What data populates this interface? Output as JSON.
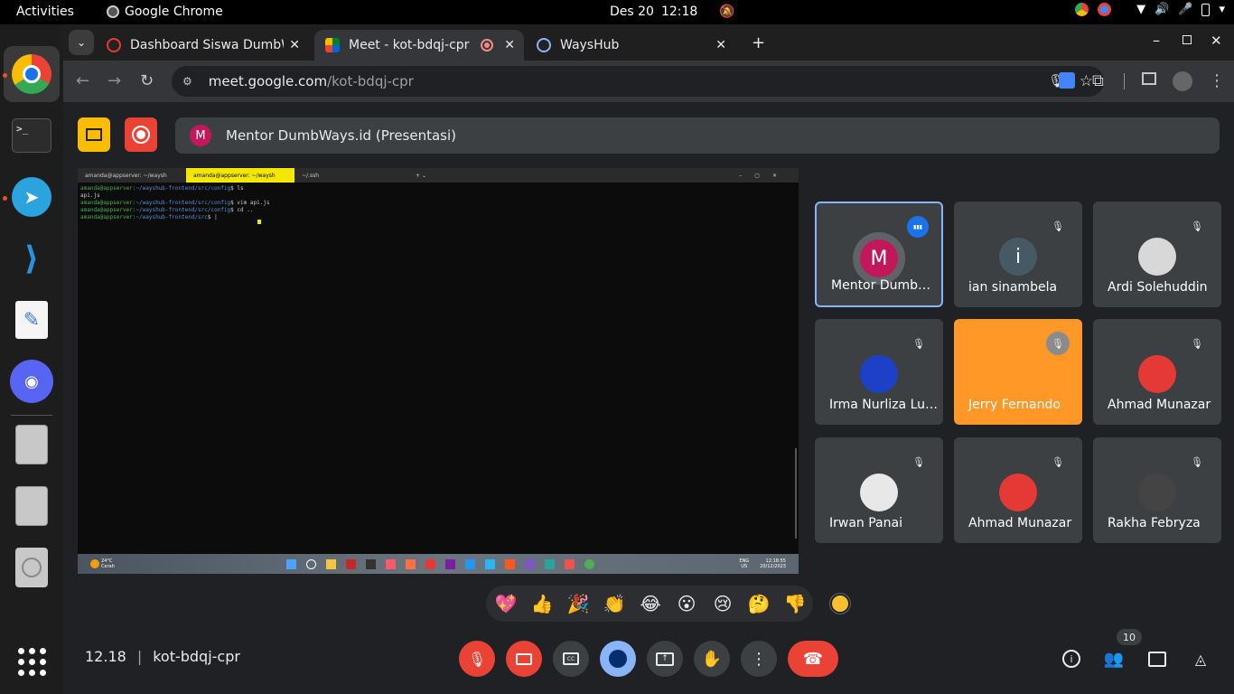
{
  "topbar": {
    "activities": "Activities",
    "app_name": "Google Chrome",
    "date": "Des 20",
    "time": "12:18"
  },
  "dock": {
    "items": [
      "chrome-icon",
      "terminal-icon",
      "telegram-icon",
      "vscode-icon",
      "text-editor-icon",
      "discord-icon",
      "drive-icon",
      "drive-icon-2",
      "disc-icon",
      "show-apps-icon"
    ]
  },
  "browser": {
    "tabs": [
      {
        "title": "Dashboard Siswa DumbW",
        "active": false
      },
      {
        "title": "Meet - kot-bdqj-cpr",
        "active": true
      },
      {
        "title": "WaysHub",
        "active": false
      }
    ],
    "url_host": "meet.google.com",
    "url_path": "/kot-bdqj-cpr"
  },
  "meet": {
    "presenter_initial": "M",
    "presenter_label": "Mentor DumbWays.id (Presentasi)",
    "time": "12.18",
    "meeting_code": "kot-bdqj-cpr",
    "participant_count": "10",
    "participants": [
      {
        "name": "Mentor Dumb…",
        "initial": "M",
        "color": "#c2185b",
        "speaking": true
      },
      {
        "name": "ian sinambela",
        "initial": "i",
        "color": "#455a64",
        "speaking": false
      },
      {
        "name": "Ardi Solehuddin",
        "initial": "",
        "color": "#d8d8d8",
        "speaking": false
      },
      {
        "name": "Irma Nurliza Lu…",
        "initial": "",
        "color": "#1e40c8",
        "speaking": false
      },
      {
        "name": "Jerry Fernando",
        "initial": "",
        "color": "#ff9826",
        "speaking": false
      },
      {
        "name": "Ahmad Munazar",
        "initial": "",
        "color": "#e53935",
        "speaking": false
      },
      {
        "name": "Irwan Panai",
        "initial": "",
        "color": "#e8e8e8",
        "speaking": false
      },
      {
        "name": "Ahmad Munazar",
        "initial": "",
        "color": "#e53935",
        "speaking": false
      },
      {
        "name": "Rakha Febryza",
        "initial": "",
        "color": "#444444",
        "speaking": false
      }
    ],
    "reactions": [
      "💖",
      "👍",
      "🎉",
      "👏",
      "😂",
      "😮",
      "😢",
      "🤔",
      "👎"
    ]
  },
  "shared_screen": {
    "tabs": [
      "amanda@appserver: ~/waysh",
      "amanda@appserver: ~/waysh",
      "~/.ssh"
    ],
    "lines": [
      {
        "prompt": "amanda@appserver",
        "path": ":~/wayshub-frontend/src/config",
        "cmd": "$ ls"
      },
      {
        "prompt": "",
        "path": "",
        "cmd": "api.js"
      },
      {
        "prompt": "amanda@appserver",
        "path": ":~/wayshub-frontend/src/config",
        "cmd": "$ vim api.js"
      },
      {
        "prompt": "amanda@appserver",
        "path": ":~/wayshub-frontend/src/config",
        "cmd": "$ cd .."
      },
      {
        "prompt": "amanda@appserver",
        "path": ":~/wayshub-frontend/src",
        "cmd": "$ |"
      }
    ],
    "weather_temp": "24°C",
    "weather_desc": "Cerah",
    "lang_top": "ENG",
    "lang_bottom": "US",
    "taskbar_time": "12:18:55",
    "taskbar_date": "20/12/2023"
  }
}
